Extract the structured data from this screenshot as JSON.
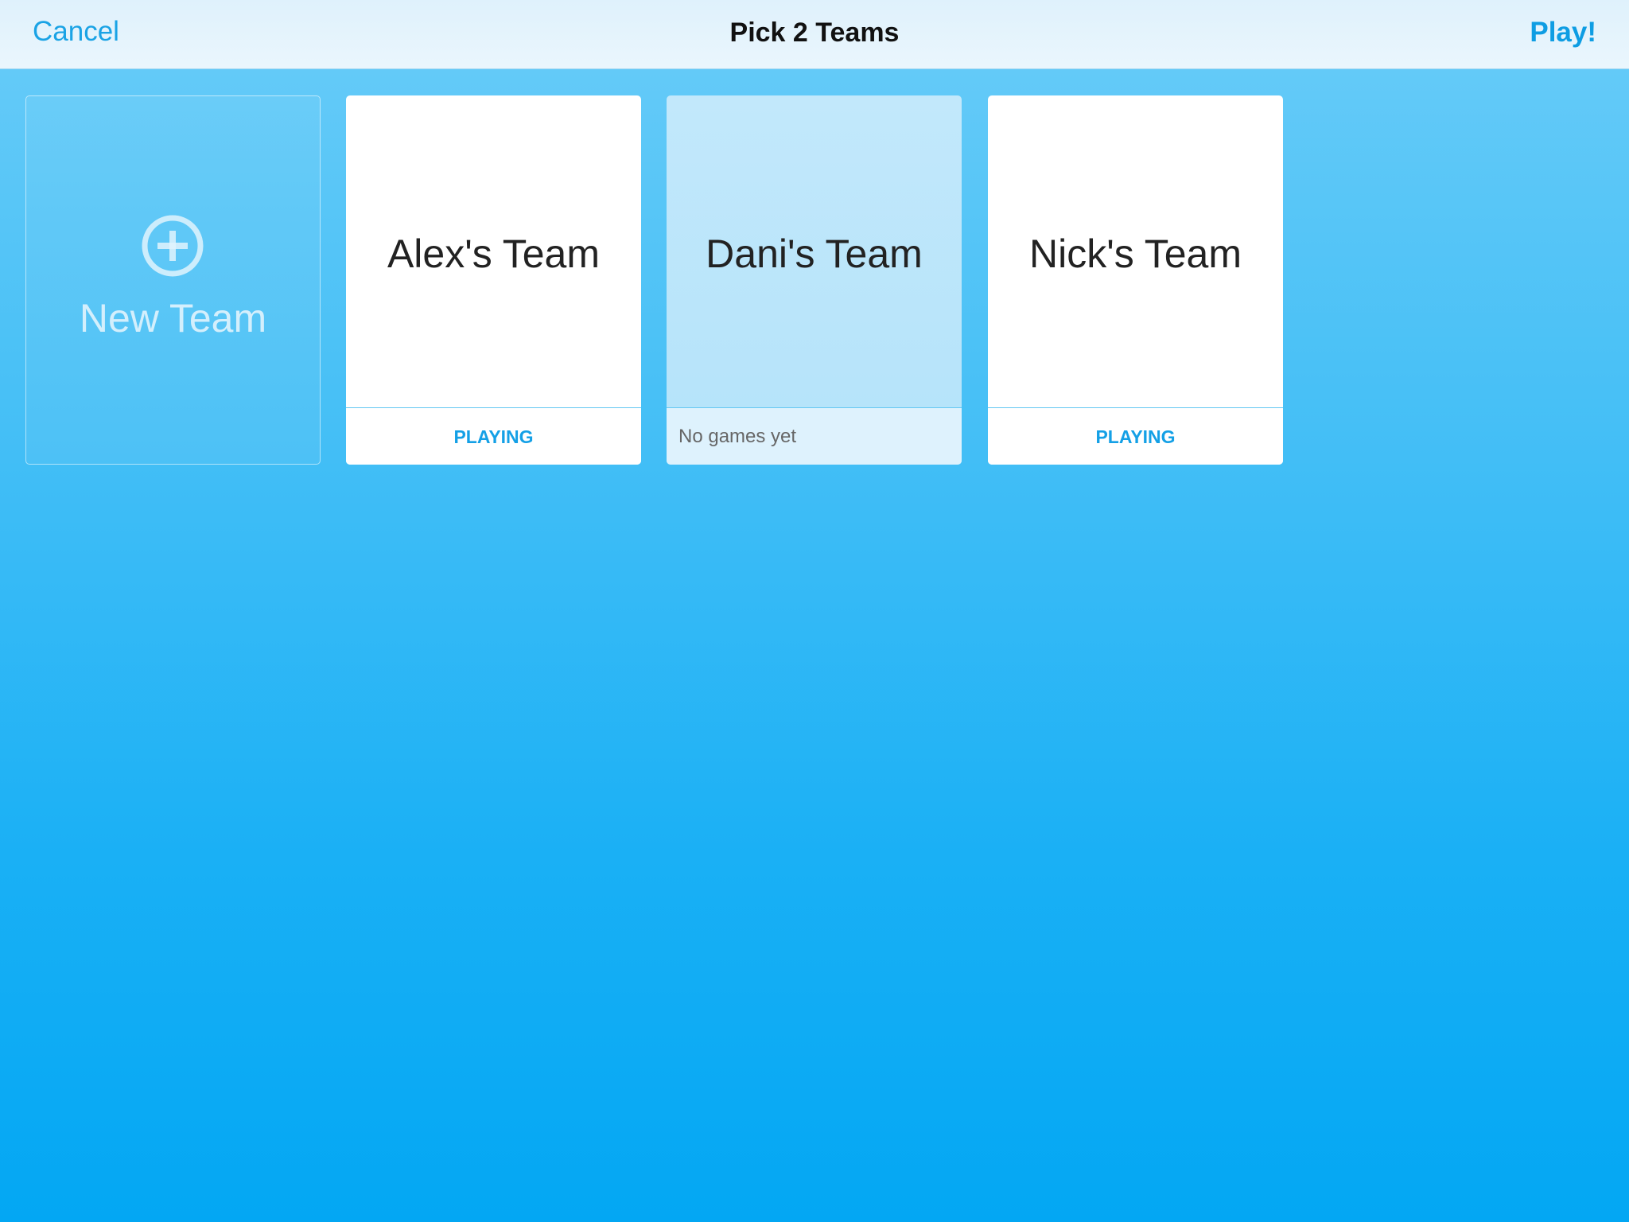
{
  "navbar": {
    "cancel_label": "Cancel",
    "title": "Pick 2 Teams",
    "play_label": "Play!"
  },
  "new_team": {
    "label": "New Team",
    "icon": "plus-circle-icon"
  },
  "teams": [
    {
      "name": "Alex's Team",
      "status": "PLAYING",
      "selected": false
    },
    {
      "name": "Dani's Team",
      "status": "No games yet",
      "selected": true
    },
    {
      "name": "Nick's Team",
      "status": "PLAYING",
      "selected": false
    }
  ],
  "colors": {
    "accent": "#1aa3e5",
    "background_top": "#69ccf8",
    "background_bottom": "#03a7f3",
    "selected_card": "#c2e8fb"
  }
}
